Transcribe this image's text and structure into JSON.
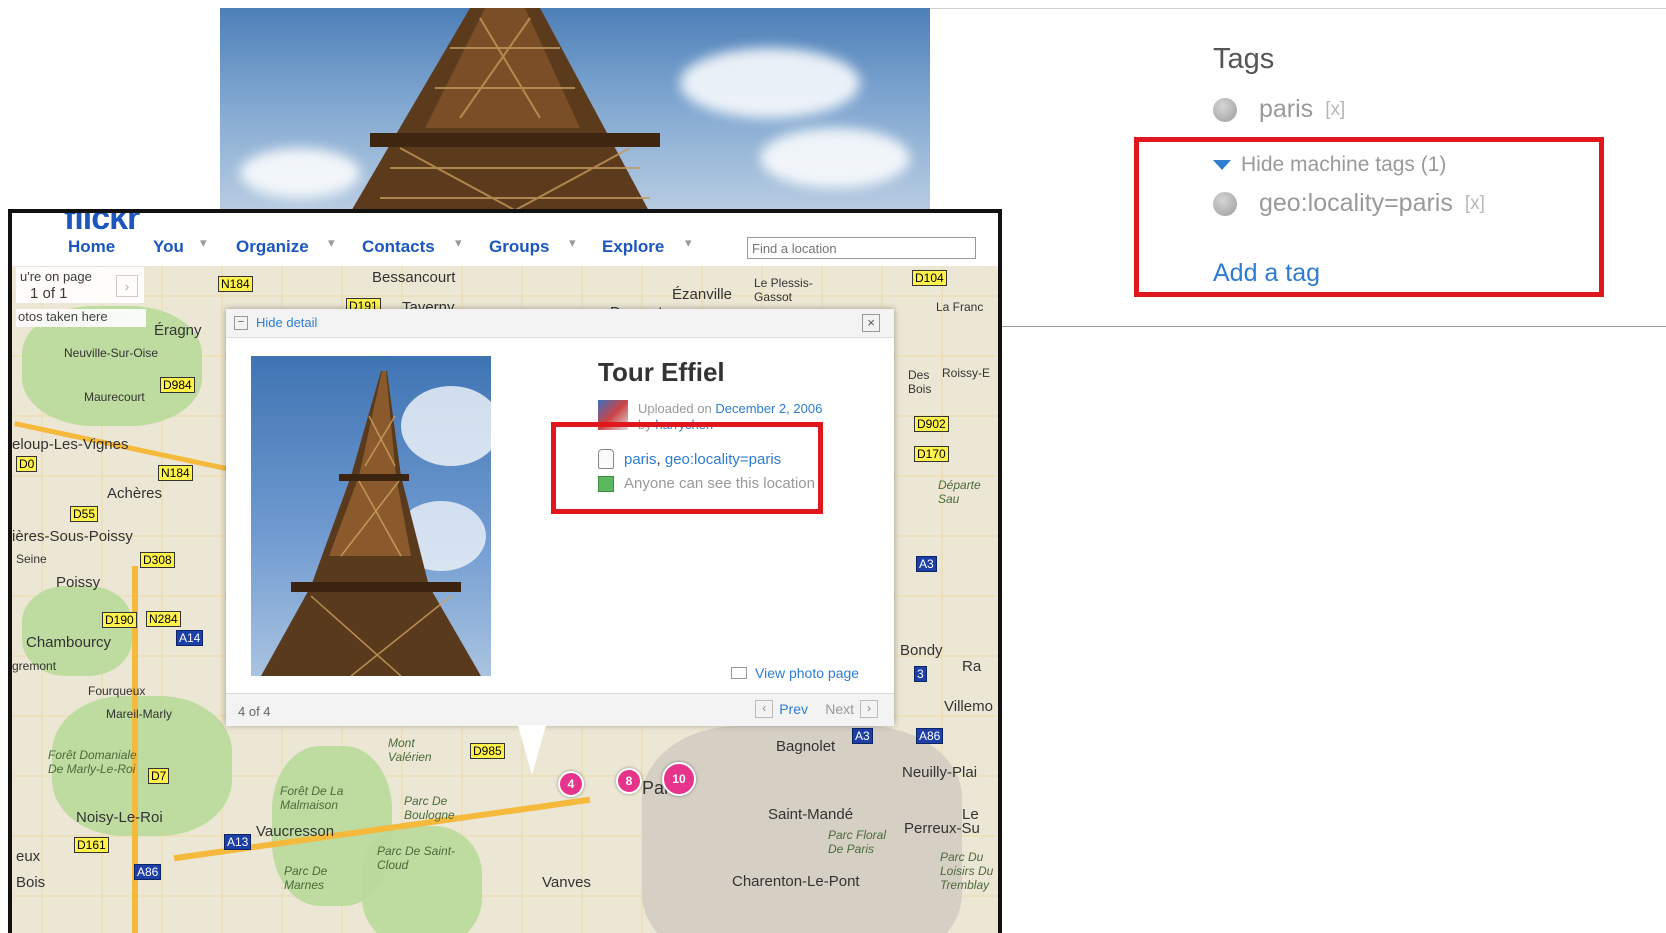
{
  "tags_panel": {
    "title": "Tags",
    "tags": [
      {
        "label": "paris",
        "remove": "[x]"
      }
    ],
    "hide_machine_tags": "Hide machine tags (1)",
    "machine_tags": [
      {
        "label": "geo:locality=paris",
        "remove": "[x]"
      }
    ],
    "add_tag": "Add a tag"
  },
  "flickr": {
    "logo": "flickr",
    "nav": [
      {
        "label": "Home"
      },
      {
        "label": "You"
      },
      {
        "label": "Organize"
      },
      {
        "label": "Contacts"
      },
      {
        "label": "Groups"
      },
      {
        "label": "Explore"
      }
    ],
    "search_placeholder": "Find a location",
    "pager": {
      "line1": "u're on page",
      "line2": "1 of 1",
      "arrow": "›"
    },
    "photos_here": "otos taken here"
  },
  "map": {
    "towns": [
      "Bessancourt",
      "Taverny",
      "Ézanville",
      "Le Plessis-Gassot",
      "Domont",
      "Éragny",
      "Neuville-Sur-Oise",
      "Maurecourt",
      "eloup-Les-Vignes",
      "Achères",
      "ières-Sous-Poissy",
      "Seine",
      "Poissy",
      "Chambourcy",
      "gremont",
      "Fourqueux",
      "Mareil-Marly",
      "Forêt Domaniale De Marly-Le-Roi",
      "Noisy-Le-Roi",
      "Vaucresson",
      "Forêt De La Malmaison",
      "Parc De Boulogne",
      "Parc De Saint-Cloud",
      "Parc De Marnes",
      "Vanves",
      "Charenton-Le-Pont",
      "Saint-Mandé",
      "Bagnolet",
      "Neuilly-Plai",
      "Perreux-Su",
      "Villemo",
      "Bondy",
      "Roissy-E",
      "La Franc",
      "Mont Valérien",
      "Parc Floral De Paris",
      "Parc Du Loisirs Du Tremblay",
      "eux",
      "Bois",
      "Départe Sau",
      "Des Bois",
      "Ra",
      "Pari",
      "Le"
    ],
    "roads": [
      "N184",
      "D191",
      "D104",
      "D984",
      "N184",
      "D55",
      "D308",
      "D190",
      "N284",
      "A14",
      "D7",
      "D161",
      "A13",
      "A86",
      "D985",
      "A3",
      "A86",
      "A3",
      "D902",
      "D170",
      "D0",
      "3"
    ],
    "markers": [
      "4",
      "8",
      "10"
    ]
  },
  "popup": {
    "hide_detail": "Hide detail",
    "close": "×",
    "title": "Tour Effiel",
    "uploaded_prefix": "Uploaded on ",
    "uploaded_date": "December 2, 2006",
    "by_prefix": "by ",
    "by_user": "harrychen",
    "tag_paris": "paris",
    "tag_sep": ", ",
    "tag_geo": "geo:locality=paris",
    "visibility": "Anyone can see this location",
    "view_photo": "View photo page",
    "count": "4 of 4",
    "prev": "Prev",
    "next": "Next",
    "prev_arrow": "‹",
    "next_arrow": "›"
  },
  "colors": {
    "link_blue": "#2e7dd1",
    "highlight_red": "#e0181e",
    "marker_pink": "#e8338a",
    "road_yellow": "#fff24a"
  }
}
